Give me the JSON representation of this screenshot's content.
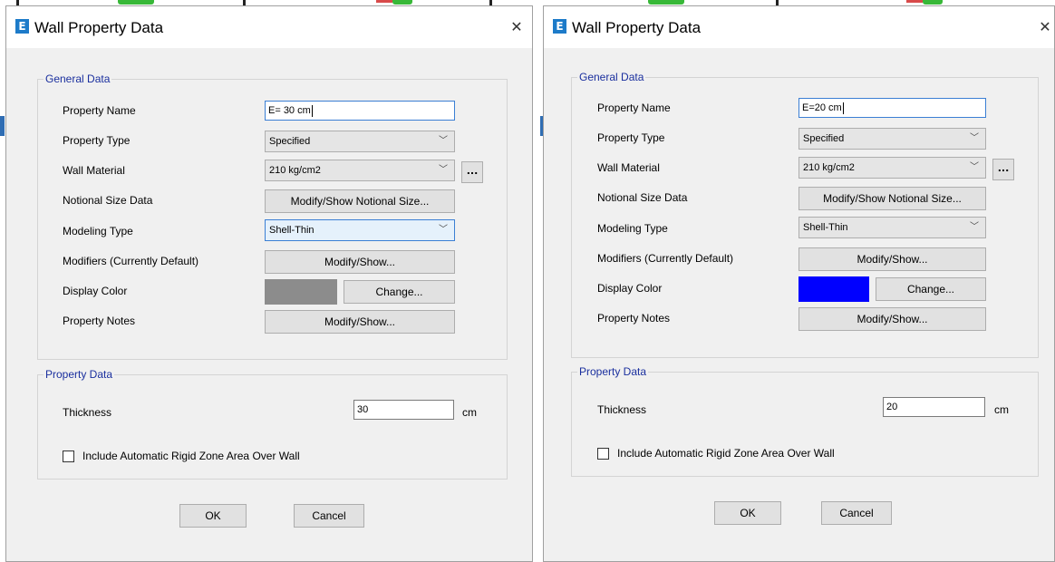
{
  "dialogs": [
    {
      "title": "Wall Property Data",
      "general_data": {
        "legend": "General Data",
        "property_name": {
          "label": "Property Name",
          "value": "E= 30 cm"
        },
        "property_type": {
          "label": "Property Type",
          "value": "Specified"
        },
        "wall_material": {
          "label": "Wall Material",
          "value": "210 kg/cm2",
          "browse": "..."
        },
        "notional_size": {
          "label": "Notional Size Data",
          "button": "Modify/Show Notional Size..."
        },
        "modeling_type": {
          "label": "Modeling Type",
          "value": "Shell-Thin"
        },
        "modifiers": {
          "label": "Modifiers (Currently Default)",
          "button": "Modify/Show..."
        },
        "display_color": {
          "label": "Display Color",
          "color": "#8c8c8c",
          "button": "Change..."
        },
        "property_notes": {
          "label": "Property Notes",
          "button": "Modify/Show..."
        }
      },
      "property_data": {
        "legend": "Property Data",
        "thickness": {
          "label": "Thickness",
          "value": "30",
          "unit": "cm"
        },
        "rigid_zone": {
          "label": "Include Automatic Rigid Zone Area Over Wall",
          "checked": false
        }
      },
      "ok": "OK",
      "cancel": "Cancel"
    },
    {
      "title": "Wall Property Data",
      "general_data": {
        "legend": "General Data",
        "property_name": {
          "label": "Property Name",
          "value": "E=20 cm"
        },
        "property_type": {
          "label": "Property Type",
          "value": "Specified"
        },
        "wall_material": {
          "label": "Wall Material",
          "value": "210 kg/cm2",
          "browse": "..."
        },
        "notional_size": {
          "label": "Notional Size Data",
          "button": "Modify/Show Notional Size..."
        },
        "modeling_type": {
          "label": "Modeling Type",
          "value": "Shell-Thin"
        },
        "modifiers": {
          "label": "Modifiers (Currently Default)",
          "button": "Modify/Show..."
        },
        "display_color": {
          "label": "Display Color",
          "color": "#0000ff",
          "button": "Change..."
        },
        "property_notes": {
          "label": "Property Notes",
          "button": "Modify/Show..."
        }
      },
      "property_data": {
        "legend": "Property Data",
        "thickness": {
          "label": "Thickness",
          "value": "20",
          "unit": "cm"
        },
        "rigid_zone": {
          "label": "Include Automatic Rigid Zone Area Over Wall",
          "checked": false
        }
      },
      "ok": "OK",
      "cancel": "Cancel"
    }
  ],
  "icons": {
    "app": "etabs-app-icon",
    "close": "close-icon",
    "dropdown": "chevron-down-icon"
  },
  "colors": {
    "group_label": "#1a2f9e",
    "focus_border": "#3b7fd4",
    "dialog_bg": "#f0f0f0"
  }
}
